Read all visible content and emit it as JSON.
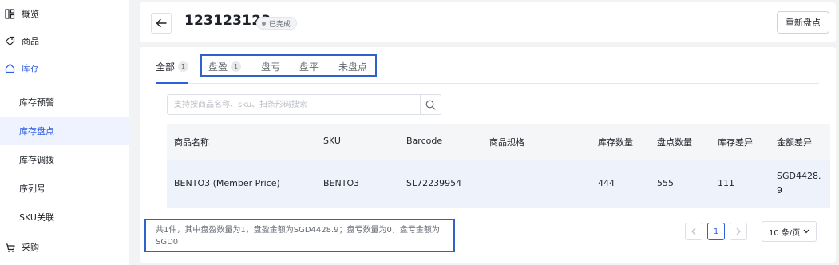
{
  "sidebar": {
    "overview": "概览",
    "products": "商品",
    "inventory": "库存",
    "items": [
      "库存预警",
      "库存盘点",
      "库存调拨",
      "序列号",
      "SKU关联"
    ],
    "purchase": "采购"
  },
  "header": {
    "title": "123123123",
    "status": "已完成",
    "recount_label": "重新盘点"
  },
  "tabs": [
    {
      "label": "全部",
      "count": "1"
    },
    {
      "label": "盘盈",
      "count": "1"
    },
    {
      "label": "盘亏",
      "count": ""
    },
    {
      "label": "盘平",
      "count": ""
    },
    {
      "label": "未盘点",
      "count": ""
    }
  ],
  "search": {
    "placeholder": "支持按商品名称、sku、扫条形码搜索",
    "value": ""
  },
  "table": {
    "columns": [
      "商品名称",
      "SKU",
      "Barcode",
      "商品规格",
      "库存数量",
      "盘点数量",
      "库存差异",
      "金额差异"
    ],
    "rows": [
      {
        "name": "BENTO3 (Member Price)",
        "sku": "BENTO3",
        "barcode": "SL72239954",
        "spec": "",
        "stock": "444",
        "counted": "555",
        "stock_diff": "111",
        "amount_diff_1": "SGD4428.",
        "amount_diff_2": "9"
      }
    ]
  },
  "summary": {
    "line1": "共1件，其中盘盈数量为1，盘盈金额为SGD4428.9；盘亏数量为0，盘亏金额为",
    "line2": "SGD0"
  },
  "pagination": {
    "current": "1",
    "page_size": "10 条/页"
  },
  "colors": {
    "accent": "#2f5fe0",
    "highlight_box": "#2f62c8",
    "row_bg": "#eef3fb"
  }
}
